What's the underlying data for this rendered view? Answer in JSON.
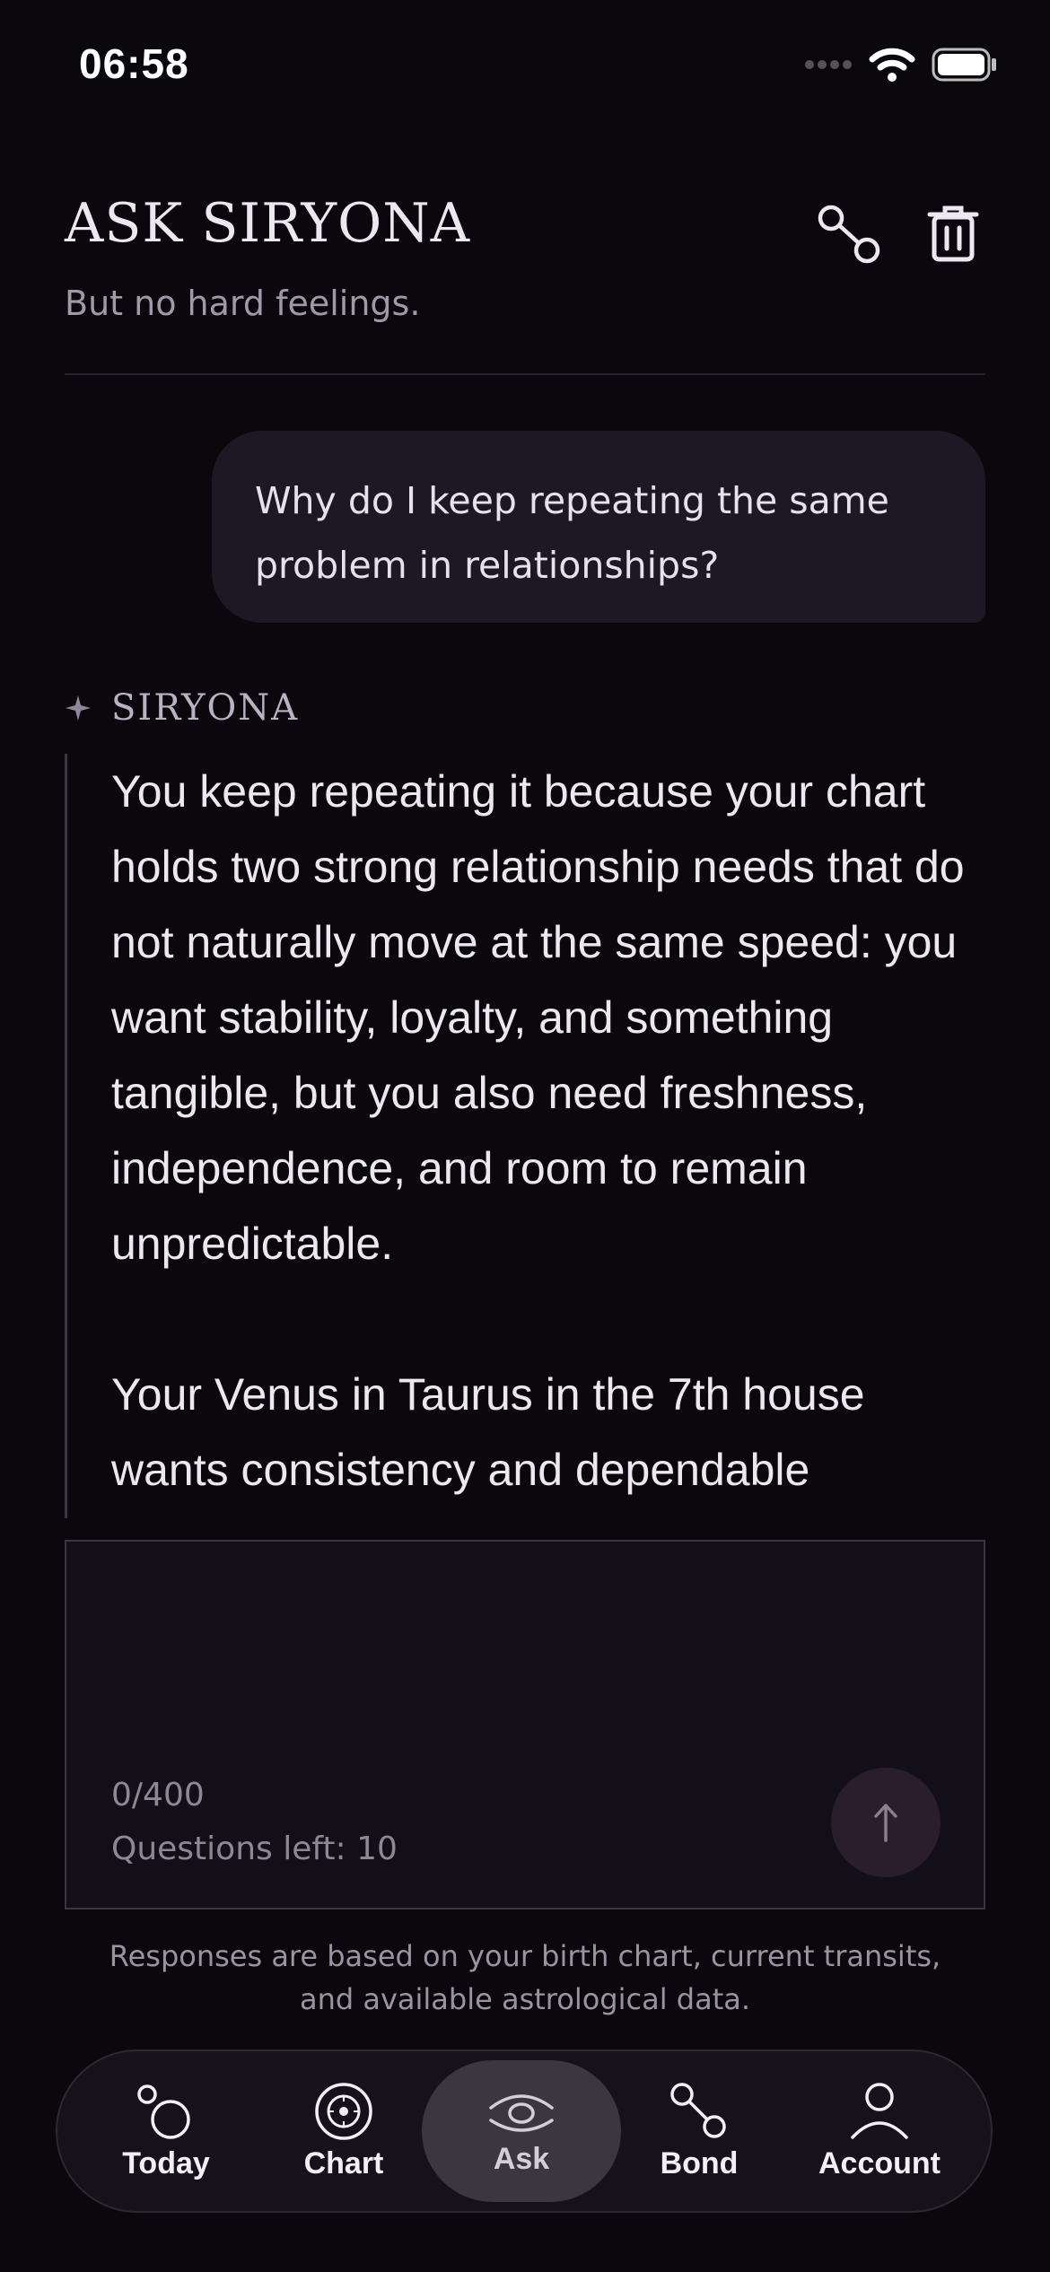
{
  "status_bar": {
    "time": "06:58"
  },
  "header": {
    "title": "ASK SIRYONA",
    "subtitle": "But no hard feelings."
  },
  "conversation": {
    "user_message": "Why do I keep repeating the same problem in relationships?",
    "assistant_name": "SIRYONA",
    "assistant_message": "You keep repeating it because your chart holds two strong relationship needs that do not naturally move at the same speed: you want stability, loyalty, and something tangible, but you also need freshness, independence, and room to remain unpredictable.\n\nYour Venus in Taurus in the 7th house wants consistency and dependable"
  },
  "composer": {
    "char_count": "0/400",
    "questions_left": "Questions left: 10"
  },
  "disclaimer": "Responses are based on your birth chart, current transits, and available astrological data.",
  "tabs": [
    {
      "label": "Today",
      "icon": "bubbles-icon"
    },
    {
      "label": "Chart",
      "icon": "chart-wheel-icon"
    },
    {
      "label": "Ask",
      "icon": "eye-icon",
      "active": true
    },
    {
      "label": "Bond",
      "icon": "bond-link-icon"
    },
    {
      "label": "Account",
      "icon": "person-icon"
    }
  ],
  "colors": {
    "background": "#0a080d",
    "user_bubble": "#1e1826",
    "send_button": "#2a1d2e",
    "active_tab": "#3a3740"
  }
}
